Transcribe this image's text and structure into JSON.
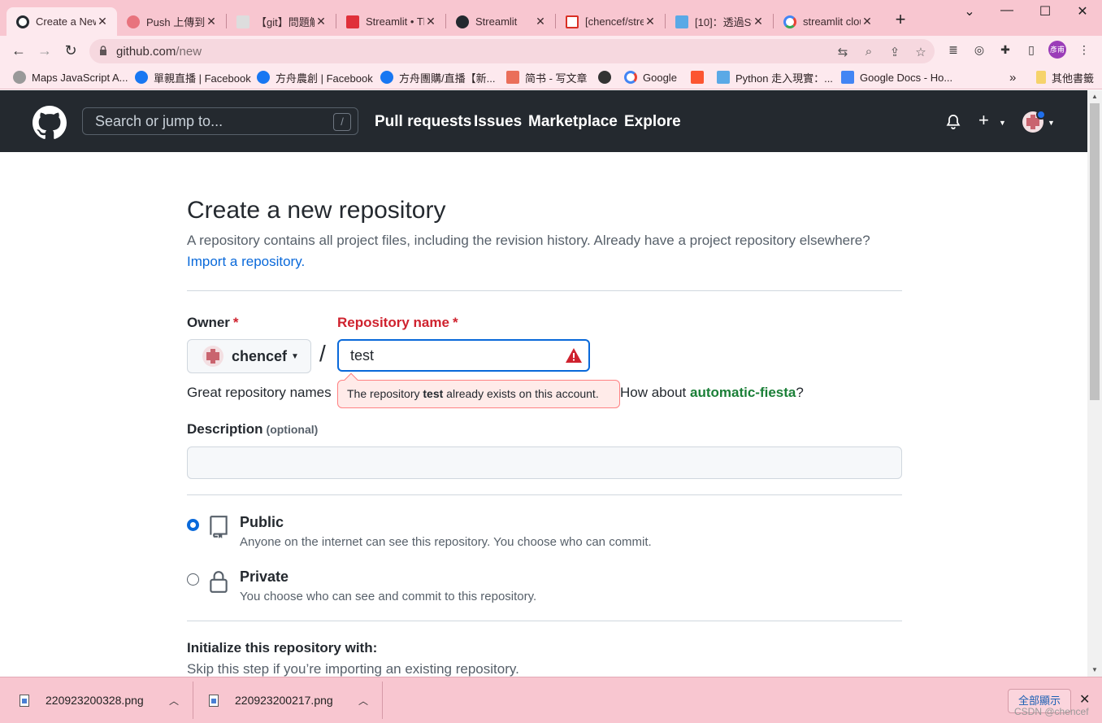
{
  "browser": {
    "tabs": [
      {
        "title": "Create a New",
        "close": "✕"
      },
      {
        "title": "Push 上傳到",
        "close": "✕"
      },
      {
        "title": "【git】問題解",
        "close": "✕"
      },
      {
        "title": "Streamlit • Th",
        "close": "✕"
      },
      {
        "title": "Streamlit",
        "close": "✕"
      },
      {
        "title": "[chencef/stre",
        "close": "✕"
      },
      {
        "title": "[10]：透過St",
        "close": "✕"
      },
      {
        "title": "streamlit clou",
        "close": "✕"
      }
    ],
    "new_tab": "+",
    "window_controls": {
      "minimize": "⌄",
      "min": "—",
      "max": "☐",
      "close": "✕"
    },
    "url_host": "github.com",
    "url_path": "/new",
    "profile_label": "彥甫",
    "bookmarks": [
      "Maps JavaScript A...",
      "單親直播 | Facebook",
      "方舟農創 | Facebook",
      "方舟團購/直播【新...",
      "简书 - 写文章",
      "",
      "Google",
      "",
      "Python 走入現實：...",
      "Google Docs - Ho..."
    ],
    "bookmarks_more": "»",
    "other_bookmarks": "其他書籤"
  },
  "github": {
    "search_placeholder": "Search or jump to...",
    "search_shortcut": "/",
    "nav": {
      "pull_requests": "Pull requests",
      "issues": "Issues",
      "marketplace": "Marketplace",
      "explore": "Explore"
    },
    "plus": "+"
  },
  "form": {
    "title": "Create a new repository",
    "subtitle": "A repository contains all project files, including the revision history. Already have a project repository elsewhere?",
    "import_link": "Import a repository.",
    "owner_label": "Owner",
    "required_mark": "*",
    "owner_name": "chencef",
    "separator": "/",
    "repo_label": "Repository name",
    "repo_value": "test",
    "hint_prefix": "Great repository names",
    "hint_suffix_pre": "How about ",
    "hint_suggestion": "automatic-fiesta",
    "hint_suffix_post": "?",
    "error_pre": "The repository ",
    "error_name": "test",
    "error_post": " already exists on this account.",
    "description_label": "Description",
    "description_optional": "(optional)",
    "description_value": "",
    "visibility": [
      {
        "title": "Public",
        "desc": "Anyone on the internet can see this repository. You choose who can commit.",
        "selected": true
      },
      {
        "title": "Private",
        "desc": "You choose who can see and commit to this repository.",
        "selected": false
      }
    ],
    "init_title": "Initialize this repository with:",
    "init_desc": "Skip this step if you’re importing an existing repository."
  },
  "downloads": {
    "files": [
      "220923200328.png",
      "220923200217.png"
    ],
    "show_all": "全部顯示",
    "close": "✕"
  },
  "watermark": "CSDN @chencef",
  "colors": {
    "chrome_pink": "#f8c6d0",
    "gh_header": "#24292f",
    "link_blue": "#0969da",
    "error_red": "#cf222e",
    "success_green": "#1a7f37"
  }
}
